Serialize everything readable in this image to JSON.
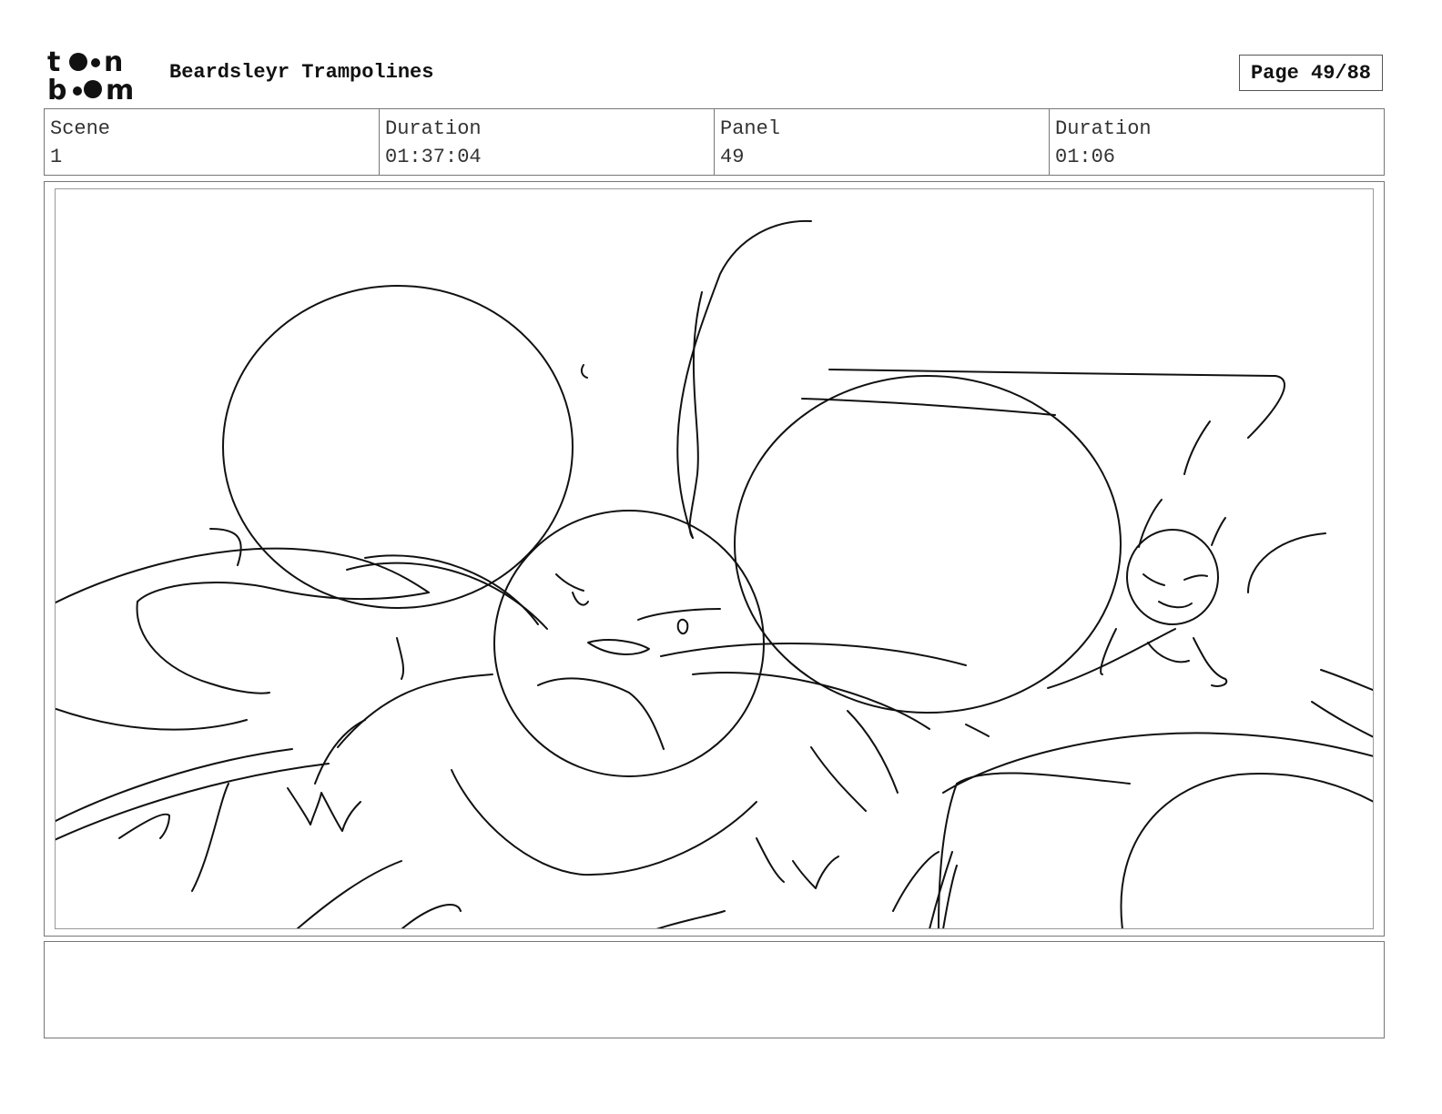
{
  "header": {
    "logo_alt": "toon boom",
    "project_title": "Beardsleyr Trampolines",
    "page_label": "Page 49/88"
  },
  "info": {
    "scene_label": "Scene",
    "scene_value": "1",
    "duration_label": "Duration",
    "duration_value": "01:37:04",
    "panel_label": "Panel",
    "panel_value": "49",
    "panel_duration_label": "Duration",
    "panel_duration_value": "01:06"
  },
  "notes": {
    "text": ""
  }
}
